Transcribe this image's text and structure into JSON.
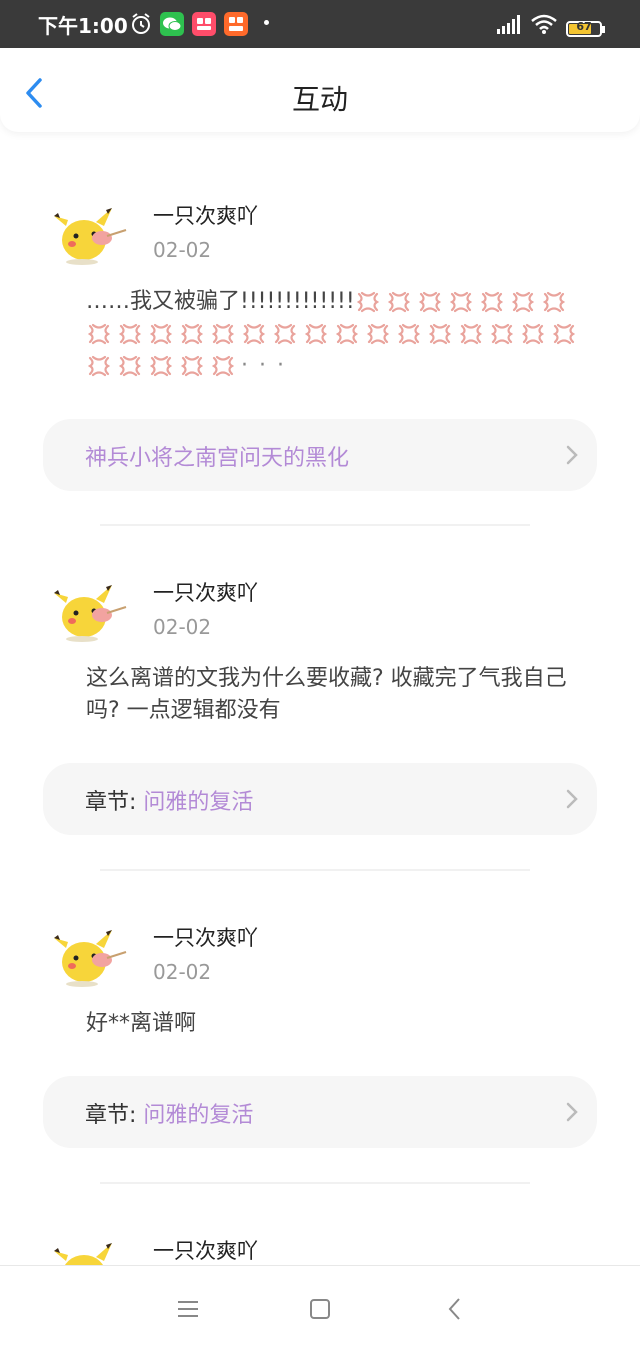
{
  "status_bar": {
    "time": "下午1:00",
    "battery": "67",
    "icons": [
      "alarm-icon",
      "wechat-icon",
      "app-icon",
      "app-icon",
      "signal-icon",
      "wifi-icon",
      "battery-icon"
    ]
  },
  "header": {
    "title": "互动",
    "back_icon": "back-arrow-icon"
  },
  "comments": [
    {
      "username": "一只次爽吖",
      "date": "02-02",
      "text": "……我又被骗了!!!!!!!!!!!!!",
      "trailing": "· · ·",
      "emoji": "anger-emoji",
      "emoji_count": 28,
      "link": {
        "prefix": "",
        "title": "神兵小将之南宫问天的黑化"
      }
    },
    {
      "username": "一只次爽吖",
      "date": "02-02",
      "text": "这么离谱的文我为什么要收藏? 收藏完了气我自己吗? 一点逻辑都没有",
      "link": {
        "prefix": "章节: ",
        "title": "问雅的复活"
      }
    },
    {
      "username": "一只次爽吖",
      "date": "02-02",
      "text": "好**离谱啊",
      "link": {
        "prefix": "章节: ",
        "title": "问雅的复活"
      }
    },
    {
      "username": "一只次爽吖"
    }
  ],
  "nav_bar": {
    "icons": [
      "menu-icon",
      "home-icon",
      "back-icon"
    ]
  },
  "colors": {
    "accent": "#2d8cf0",
    "link_purple": "#b38ad6",
    "anger_red": "#e9a39c"
  }
}
